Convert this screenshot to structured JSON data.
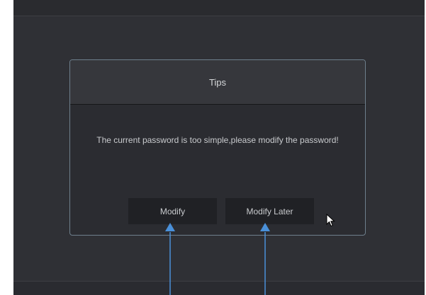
{
  "dialog": {
    "title": "Tips",
    "message": "The current password is too simple,please modify the password!",
    "buttons": {
      "modify_label": "Modify",
      "modify_later_label": "Modify Later"
    }
  },
  "colors": {
    "background": "#2f3035",
    "dialog_border": "#6e7f8c",
    "button_bg": "#202125",
    "annotation_arrow": "#4a90d9"
  },
  "icons": {
    "cursor": "mouse-pointer-icon",
    "arrow": "up-arrow-icon"
  }
}
